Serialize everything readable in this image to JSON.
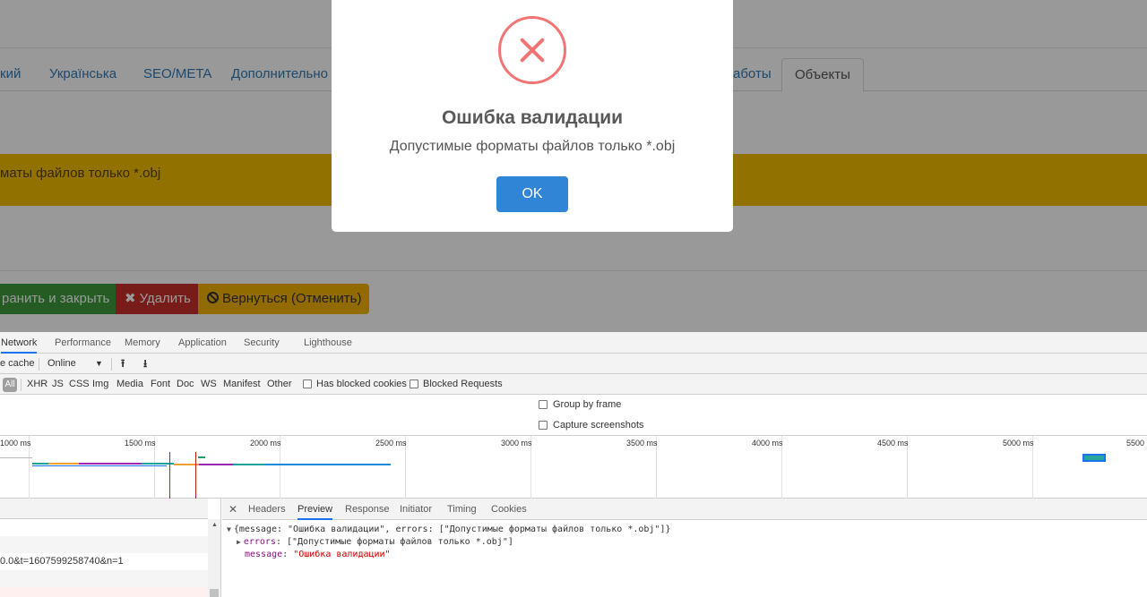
{
  "page": {
    "tabs": [
      {
        "label": "кий"
      },
      {
        "label": "Українська"
      },
      {
        "label": "SEO/META"
      },
      {
        "label": "Дополнительно"
      },
      {
        "label": "аботы"
      },
      {
        "label": "Объекты"
      }
    ],
    "alert_text": "маты файлов только *.obj",
    "buttons": {
      "save_close": "ранить и закрыть",
      "delete": "Удалить",
      "back": "Вернуться (Отменить)"
    }
  },
  "modal": {
    "title": "Ошибка валидации",
    "text": "Допустимые форматы файлов только *.obj",
    "ok": "OK",
    "icon": "error-x-icon",
    "icon_color": "#f27474",
    "button_color": "#3085d6"
  },
  "devtools": {
    "tabs": [
      "Network",
      "Performance",
      "Memory",
      "Application",
      "Security",
      "Lighthouse"
    ],
    "active_tab": "Network",
    "toolbar": {
      "cache_label": "e cache",
      "throttle": "Online"
    },
    "filters": {
      "all": "All",
      "types": [
        "XHR",
        "JS",
        "CSS",
        "Img",
        "Media",
        "Font",
        "Doc",
        "WS",
        "Manifest",
        "Other"
      ],
      "has_blocked_cookies": "Has blocked cookies",
      "blocked_requests": "Blocked Requests"
    },
    "options": {
      "group_by_frame": "Group by frame",
      "capture_screenshots": "Capture screenshots"
    },
    "timeline_ticks": [
      "1000 ms",
      "1500 ms",
      "2000 ms",
      "2500 ms",
      "3000 ms",
      "3500 ms",
      "4000 ms",
      "4500 ms",
      "5000 ms",
      "5500 m"
    ],
    "request_row_text": "0.0&t=1607599258740&n=1",
    "detail_tabs": [
      "Headers",
      "Preview",
      "Response",
      "Initiator",
      "Timing",
      "Cookies"
    ],
    "active_detail_tab": "Preview",
    "preview": {
      "line1": "{message: \"Ошибка валидации\", errors: [\"Допустимые форматы файлов только *.obj\"]}",
      "errors_key": "errors",
      "errors_value": "[\"Допустимые форматы файлов только *.obj\"]",
      "message_key": "message",
      "message_value": "\"Ошибка валидации\""
    }
  }
}
